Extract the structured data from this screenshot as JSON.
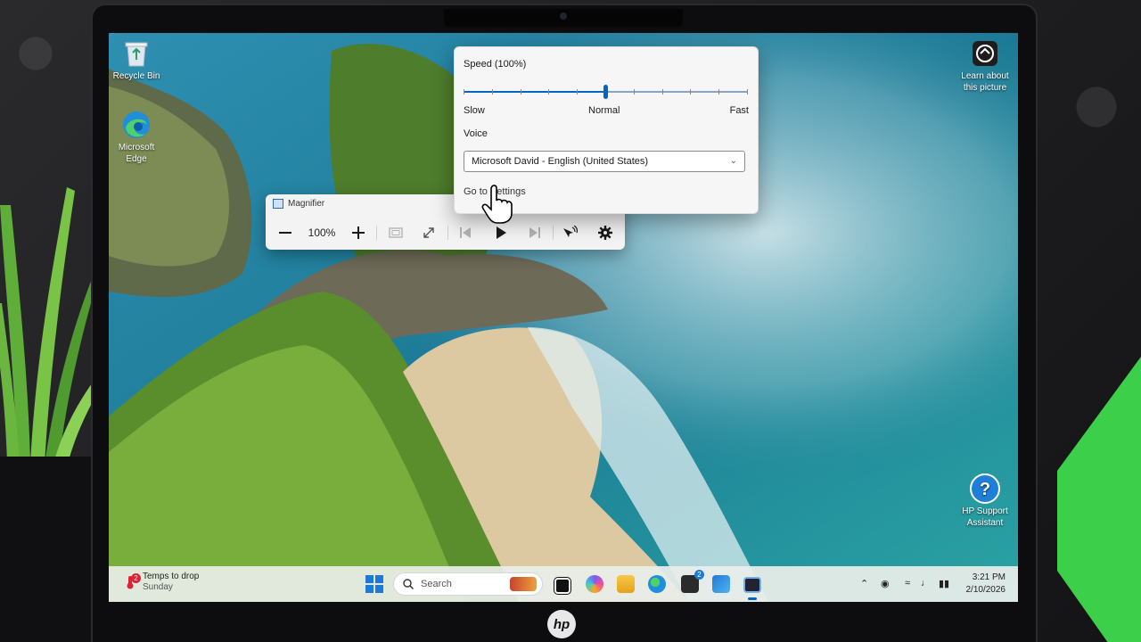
{
  "desktop": {
    "icons": [
      {
        "label": "Recycle Bin",
        "icon": "recycle-bin-icon"
      },
      {
        "label": "Microsoft Edge",
        "icon": "edge-icon"
      },
      {
        "label": "Learn about this picture",
        "icon": "camera-info-icon"
      },
      {
        "label": "HP Support Assistant",
        "icon": "help-icon"
      }
    ]
  },
  "magnifier": {
    "title": "Magnifier",
    "zoom": "100%",
    "zoom_percent": 100
  },
  "speed_flyout": {
    "speed_label": "Speed (100%)",
    "speed_level": 0.5,
    "slow_label": "Slow",
    "normal_label": "Normal",
    "fast_label": "Fast",
    "voice_label": "Voice",
    "voice_selected": "Microsoft David - English (United States)",
    "settings_link": "Go to Settings"
  },
  "taskbar": {
    "weather_title": "Temps to drop",
    "weather_subtitle": "Sunday",
    "weather_badge": "2",
    "search_placeholder": "Search",
    "store_badge": "2",
    "time": "3:21 PM",
    "date": "2/10/2026"
  },
  "laptop": {
    "brand": "hp"
  },
  "colors": {
    "accent": "#0067c0",
    "flyout_bg": "#f6f6f6",
    "taskbar_bg": "#eaeee9"
  }
}
